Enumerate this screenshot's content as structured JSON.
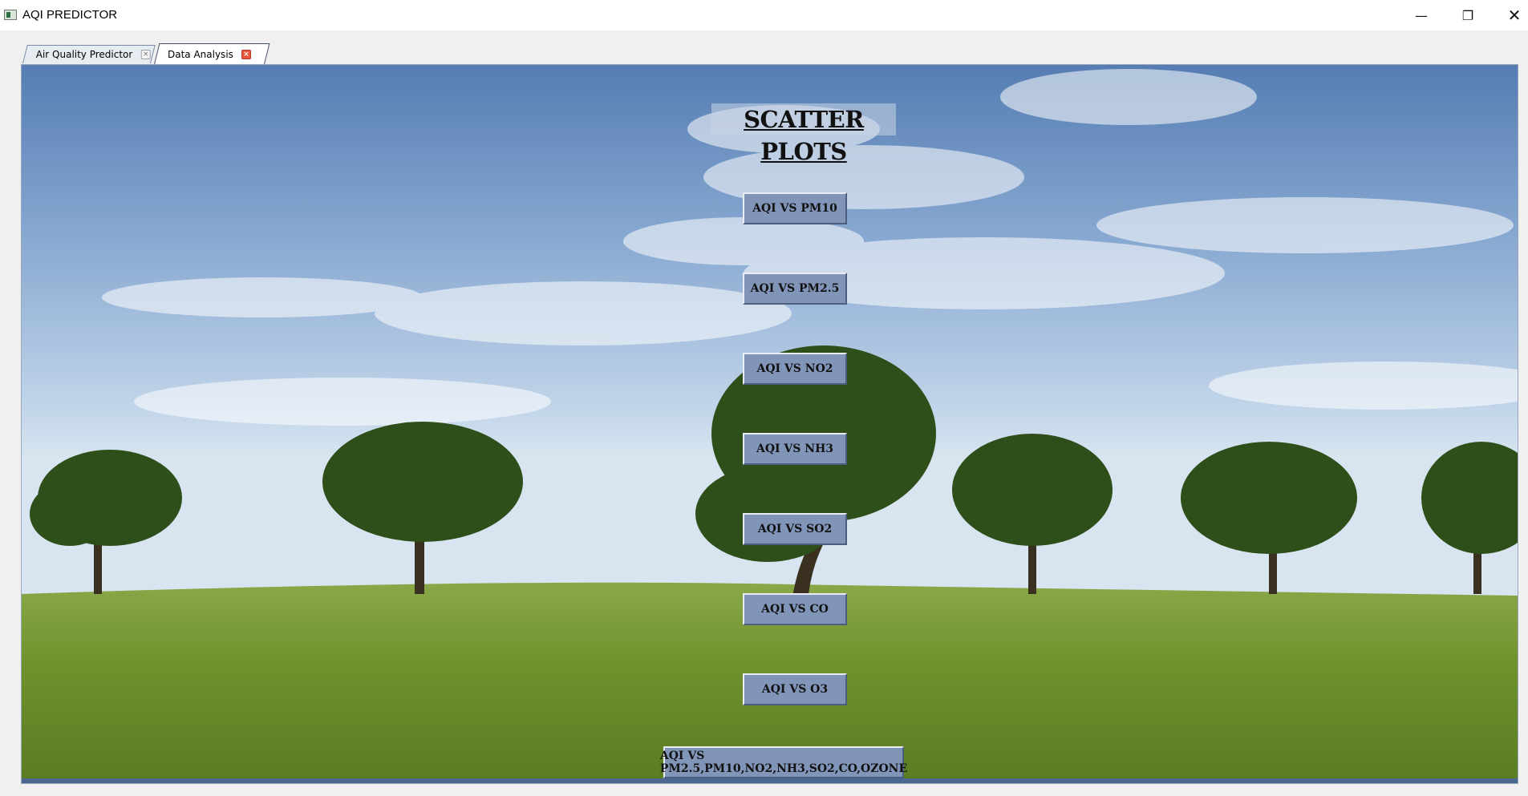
{
  "window": {
    "title": "AQI PREDICTOR",
    "minimize_glyph": "—",
    "maximize_glyph": "❐",
    "close_glyph": "✕"
  },
  "tabs": [
    {
      "label": "Air Quality Predictor",
      "close_glyph": "×",
      "active": false
    },
    {
      "label": "Data Analysis",
      "close_glyph": "×",
      "active": true
    }
  ],
  "main": {
    "heading": "SCATTER PLOTS",
    "buttons": [
      {
        "label": "AQI VS PM10"
      },
      {
        "label": "AQI VS PM2.5"
      },
      {
        "label": "AQI VS NO2"
      },
      {
        "label": "AQI VS NH3"
      },
      {
        "label": "AQI VS SO2"
      },
      {
        "label": "AQI VS CO"
      },
      {
        "label": "AQI VS O3"
      },
      {
        "label": "AQI VS PM2.5,PM10,NO2,NH3,SO2,CO,OZONE"
      }
    ]
  },
  "colors": {
    "button_bg": "#8195b9",
    "sky_top": "#5d85b8",
    "grass": "#6f8f2c"
  }
}
